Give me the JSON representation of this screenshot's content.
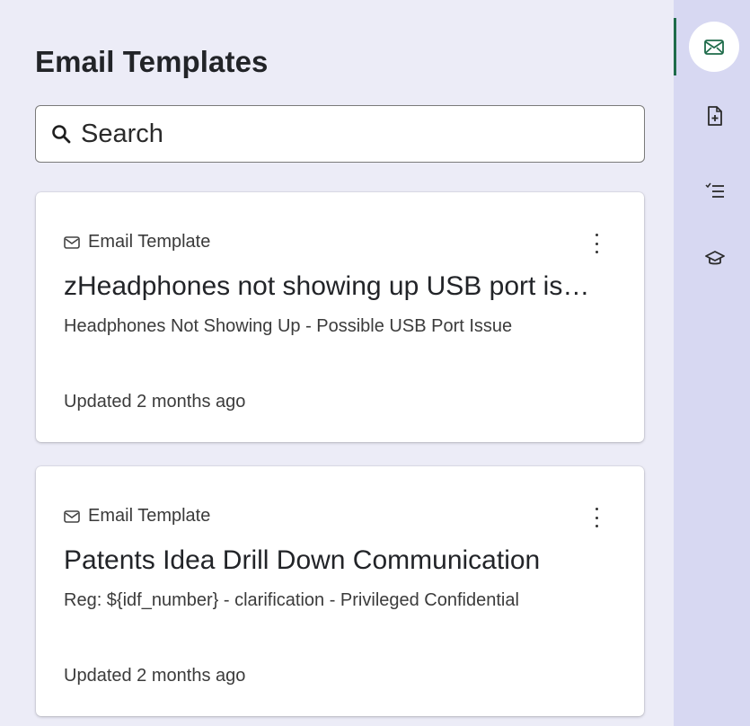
{
  "panel": {
    "title": "Email Templates",
    "search": {
      "placeholder": "Search",
      "value": ""
    }
  },
  "cards": [
    {
      "kind": "Email Template",
      "name": "zHeadphones not showing up USB port is…",
      "subject": "Headphones Not Showing Up - Possible USB Port Issue",
      "updated": "Updated 2 months ago"
    },
    {
      "kind": "Email Template",
      "name": "Patents Idea Drill Down Communication",
      "subject": "Reg: ${idf_number} - clarification - Privileged Confidential",
      "updated": "Updated 2 months ago"
    }
  ],
  "rail": {
    "items": [
      {
        "icon": "mail-template-icon",
        "active": true
      },
      {
        "icon": "new-document-icon",
        "active": false
      },
      {
        "icon": "checklist-icon",
        "active": false
      },
      {
        "icon": "graduation-cap-icon",
        "active": false
      }
    ],
    "active_color": "#1e6b4a"
  },
  "colors": {
    "panel_background": "#ececf7",
    "rail_background": "#d7d8f2",
    "card_background": "#ffffff"
  }
}
